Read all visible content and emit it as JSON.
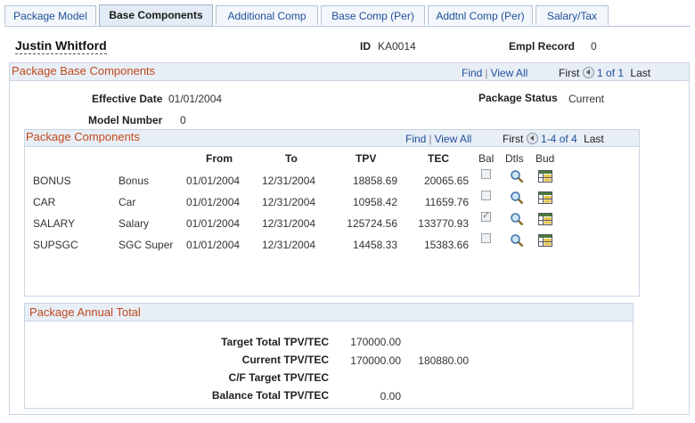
{
  "tabs": [
    {
      "label": "Package Model",
      "active": false
    },
    {
      "label": "Base Components",
      "active": true
    },
    {
      "label": "Additional Comp",
      "active": false
    },
    {
      "label": "Base Comp (Per)",
      "active": false
    },
    {
      "label": "Addtnl Comp (Per)",
      "active": false
    },
    {
      "label": "Salary/Tax",
      "active": false
    }
  ],
  "header": {
    "name": "Justin Whitford",
    "id_label": "ID",
    "id_value": "KA0014",
    "empl_record_label": "Empl Record",
    "empl_record_value": "0"
  },
  "base_group": {
    "title": "Package Base Components",
    "nav": {
      "find": "Find",
      "view_all": "View All",
      "first": "First",
      "range": "1 of 1",
      "last": "Last"
    },
    "effective_date_label": "Effective Date",
    "effective_date_value": "01/01/2004",
    "package_status_label": "Package Status",
    "package_status_value": "Current",
    "model_number_label": "Model Number",
    "model_number_value": "0"
  },
  "components": {
    "title": "Package Components",
    "nav": {
      "find": "Find",
      "view_all": "View All",
      "first": "First",
      "range": "1-4 of 4",
      "last": "Last"
    },
    "columns": {
      "from": "From",
      "to": "To",
      "tpv": "TPV",
      "tec": "TEC",
      "bal": "Bal",
      "dtls": "Dtls",
      "bud": "Bud"
    },
    "rows": [
      {
        "code": "BONUS",
        "desc": "Bonus",
        "from": "01/01/2004",
        "to": "12/31/2004",
        "tpv": "18858.69",
        "tec": "20065.65",
        "bal": false
      },
      {
        "code": "CAR",
        "desc": "Car",
        "from": "01/01/2004",
        "to": "12/31/2004",
        "tpv": "10958.42",
        "tec": "11659.76",
        "bal": false
      },
      {
        "code": "SALARY",
        "desc": "Salary",
        "from": "01/01/2004",
        "to": "12/31/2004",
        "tpv": "125724.56",
        "tec": "133770.93",
        "bal": true
      },
      {
        "code": "SUPSGC",
        "desc": "SGC Super",
        "from": "01/01/2004",
        "to": "12/31/2004",
        "tpv": "14458.33",
        "tec": "15383.66",
        "bal": false
      }
    ]
  },
  "annual_total": {
    "title": "Package Annual Total",
    "target_label": "Target Total TPV/TEC",
    "target_value": "170000.00",
    "current_label": "Current TPV/TEC",
    "current_tpv": "170000.00",
    "current_tec": "180880.00",
    "cf_label": "C/F Target TPV/TEC",
    "balance_label": "Balance Total TPV/TEC",
    "balance_value": "0.00"
  }
}
